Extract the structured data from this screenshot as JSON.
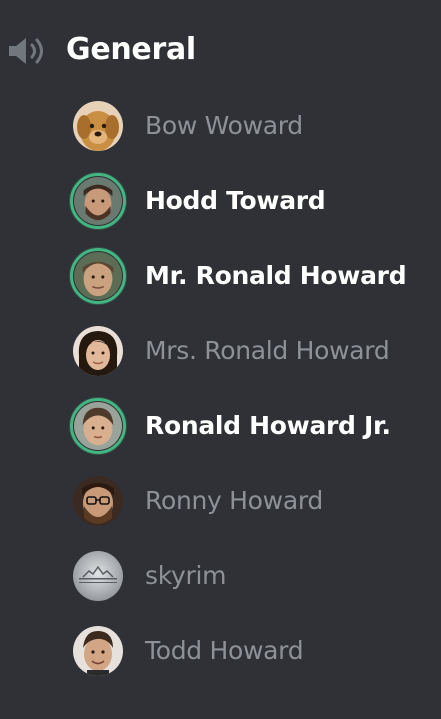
{
  "channel": {
    "name": "General",
    "icon": "speaker-icon"
  },
  "members": [
    {
      "name": "Bow Woward",
      "speaking": false,
      "avatar": "golden-retriever-avatar"
    },
    {
      "name": "Hodd Toward",
      "speaking": true,
      "avatar": "bearded-man-avatar"
    },
    {
      "name": "Mr. Ronald Howard",
      "speaking": true,
      "avatar": "older-man-avatar"
    },
    {
      "name": "Mrs. Ronald Howard",
      "speaking": false,
      "avatar": "woman-avatar"
    },
    {
      "name": "Ronald Howard Jr.",
      "speaking": true,
      "avatar": "child-avatar"
    },
    {
      "name": "Ronny Howard",
      "speaking": false,
      "avatar": "glasses-man-avatar"
    },
    {
      "name": "skyrim",
      "speaking": false,
      "avatar": "skyrim-logo-avatar"
    },
    {
      "name": "Todd Howard",
      "speaking": false,
      "avatar": "todd-howard-avatar"
    }
  ],
  "colors": {
    "background": "#2f3136",
    "speaking_ring": "#43b581",
    "dim_text": "#8e9297",
    "active_text": "#ffffff"
  }
}
